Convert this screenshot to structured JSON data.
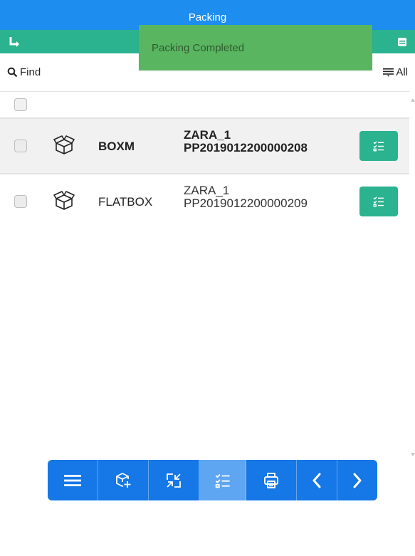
{
  "window": {
    "title": "Packing"
  },
  "toast": {
    "message": "Packing Completed"
  },
  "filter": {
    "find_label": "Find",
    "all_label": "All"
  },
  "rows": [
    {
      "code": "BOXM",
      "ref_line1": "ZARA_1",
      "ref_line2": "PP2019012200000208",
      "selected": true
    },
    {
      "code": "FLATBOX",
      "ref_line1": "ZARA_1",
      "ref_line2": "PP2019012200000209",
      "selected": false
    }
  ],
  "toolbar": {
    "buttons": [
      {
        "icon": "menu-icon"
      },
      {
        "icon": "add-box-icon"
      },
      {
        "icon": "compress-icon"
      },
      {
        "icon": "checklist-icon",
        "active": true
      },
      {
        "icon": "print-icon"
      },
      {
        "icon": "chevron-left-icon"
      },
      {
        "icon": "chevron-right-icon"
      }
    ]
  },
  "colors": {
    "titlebar": "#1d8ef0",
    "subbar": "#2bb28f",
    "toast": "#5ab561",
    "toolbar": "#1677e6",
    "toolbar_active": "#5ea6f2",
    "detail_button": "#2bb28f"
  }
}
